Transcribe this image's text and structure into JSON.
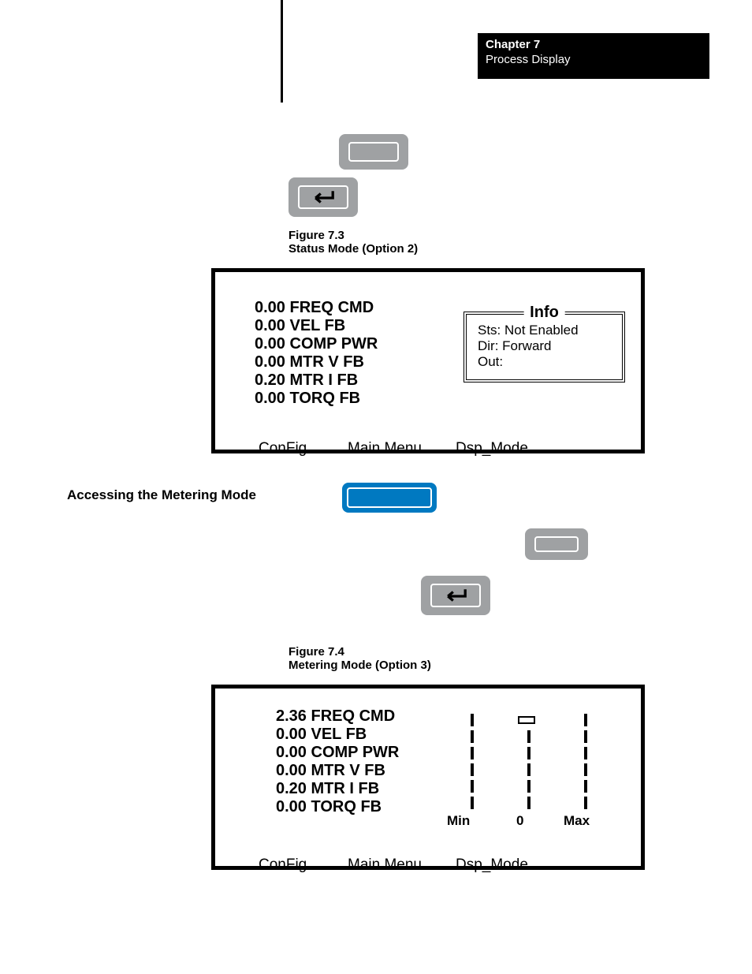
{
  "header": {
    "chapter": "Chapter 7",
    "title": "Process Display"
  },
  "fig73": {
    "num": "Figure 7.3",
    "caption": "Status Mode (Option 2)"
  },
  "fig74": {
    "num": "Figure 7.4",
    "caption": "Metering Mode (Option 3)"
  },
  "section_heading": "Accessing the Metering Mode",
  "info": {
    "legend": "Info",
    "sts": "Sts: Not Enabled",
    "dir": "Dir: Forward",
    "out": "Out:"
  },
  "softkeys": {
    "config": "ConFig",
    "main": "Main Menu",
    "dsp": "Dsp_Mode"
  },
  "axis": {
    "min": "Min",
    "zero": "0",
    "max": "Max"
  },
  "screen1": {
    "params": [
      {
        "val": "0.00",
        "name": "FREQ CMD"
      },
      {
        "val": "0.00",
        "name": "VEL FB"
      },
      {
        "val": "0.00",
        "name": "COMP PWR"
      },
      {
        "val": "0.00",
        "name": "MTR V FB"
      },
      {
        "val": "0.20",
        "name": "MTR I FB"
      },
      {
        "val": "0.00",
        "name": "TORQ FB"
      }
    ]
  },
  "screen2": {
    "params": [
      {
        "val": "2.36",
        "name": "FREQ CMD"
      },
      {
        "val": "0.00",
        "name": "VEL FB"
      },
      {
        "val": "0.00",
        "name": "COMP PWR"
      },
      {
        "val": "0.00",
        "name": "MTR V FB"
      },
      {
        "val": "0.20",
        "name": "MTR I FB"
      },
      {
        "val": "0.00",
        "name": "TORQ FB"
      }
    ]
  },
  "icons": {
    "enter": "enter-arrow-icon",
    "button": "blank-button-icon"
  }
}
